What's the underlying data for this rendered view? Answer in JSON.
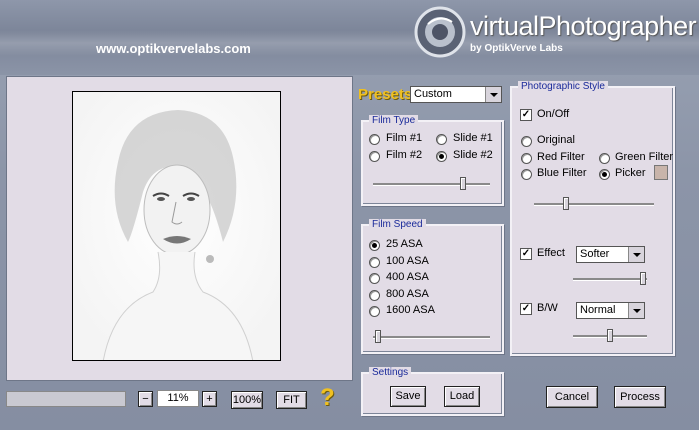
{
  "header": {
    "website": "www.optikvervelabs.com",
    "app_title": "virtualPhotographer",
    "byline": "by OptikVerve Labs"
  },
  "presets": {
    "label": "Presets",
    "selected": "Custom"
  },
  "film_type": {
    "title": "Film Type",
    "options": [
      "Film #1",
      "Slide #1",
      "Film #2",
      "Slide #2"
    ],
    "selected": "Slide #2",
    "slider_value": 0.78
  },
  "film_speed": {
    "title": "Film Speed",
    "options": [
      "25 ASA",
      "100 ASA",
      "400 ASA",
      "800 ASA",
      "1600 ASA"
    ],
    "selected": "25 ASA",
    "slider_value": 0.02
  },
  "settings": {
    "title": "Settings",
    "save_label": "Save",
    "load_label": "Load"
  },
  "photographic_style": {
    "title": "Photographic Style",
    "onoff_label": "On/Off",
    "onoff_checked": true,
    "options": [
      "Original",
      "Red Filter",
      "Green Filter",
      "Blue Filter",
      "Picker"
    ],
    "selected": "Picker",
    "picker_color": "#c8b4aa",
    "style_slider_value": 0.25,
    "effect_label": "Effect",
    "effect_checked": true,
    "effect_value": "Softer",
    "effect_slider_value": 0.98,
    "bw_label": "B/W",
    "bw_checked": true,
    "bw_value": "Normal",
    "bw_slider_value": 0.5
  },
  "zoom": {
    "minus_label": "−",
    "value": "11%",
    "plus_label": "+",
    "hundred_label": "100%",
    "fit_label": "FIT"
  },
  "help_label": "?",
  "actions": {
    "cancel_label": "Cancel",
    "process_label": "Process"
  },
  "colors": {
    "legend_text": "#1a2a9a",
    "presets_gold": "#f0c020",
    "panel_bg": "#e2dce6"
  }
}
